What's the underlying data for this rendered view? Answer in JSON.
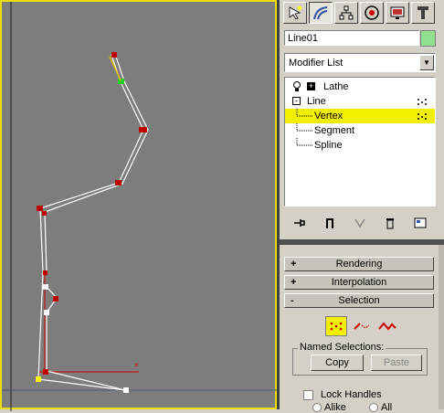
{
  "command_panel": {
    "tabs": [
      "create-icon",
      "modify-icon",
      "hierarchy-icon",
      "motion-icon",
      "display-icon",
      "utilities-icon"
    ],
    "active_tab": "modify-icon",
    "object_name": "Line01",
    "object_color": "#90e090",
    "modifier_list_label": "Modifier List",
    "stack": [
      {
        "label": "Lathe",
        "icon": "bulb-icon",
        "expander": "+"
      },
      {
        "label": "Line",
        "expander": "-"
      },
      {
        "label": "Vertex",
        "selected": true
      },
      {
        "label": "Segment"
      },
      {
        "label": "Spline"
      }
    ],
    "stack_toolbar": [
      "pin-stack-icon",
      "show-end-result-icon",
      "make-unique-icon",
      "remove-modifier-icon",
      "configure-modifier-sets-icon"
    ],
    "rollouts": [
      {
        "sign": "+",
        "label": "Rendering"
      },
      {
        "sign": "+",
        "label": "Interpolation"
      },
      {
        "sign": "-",
        "label": "Selection"
      }
    ],
    "selection": {
      "modes": [
        "vertex-mode-icon",
        "segment-mode-icon",
        "spline-mode-icon"
      ],
      "active_mode": "vertex-mode-icon",
      "named_selections_label": "Named Selections:",
      "copy_label": "Copy",
      "paste_label": "Paste",
      "lock_handles_label": "Lock Handles",
      "alike_label": "Alike",
      "all_label": "All"
    }
  },
  "viewport": {
    "border_color": "#e8e000",
    "background": "#7d7d7d",
    "selected_vertex_color": "#ffff00",
    "vertex_color": "#c00000"
  }
}
